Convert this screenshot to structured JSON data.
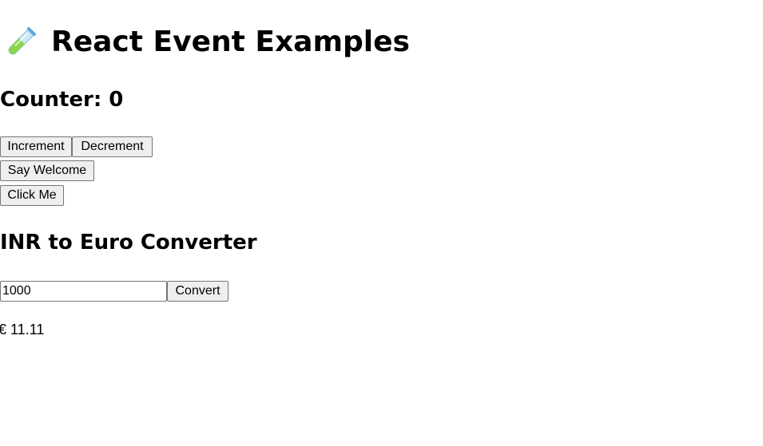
{
  "header": {
    "icon": "test-tube-icon",
    "title": "React Event Examples"
  },
  "counter": {
    "heading": "Counter: 0",
    "value": 0,
    "increment_label": "Increment",
    "decrement_label": "Decrement",
    "welcome_label": "Say Welcome",
    "click_label": "Click Me"
  },
  "converter": {
    "heading": "INR to Euro Converter",
    "input_value": "1000",
    "convert_label": "Convert",
    "result": "€ 11.11"
  },
  "colors": {
    "button_bg": "#efefef",
    "button_border": "#767676",
    "tube_glass": "#9fd3f0",
    "tube_liquid": "#8bd64a"
  }
}
